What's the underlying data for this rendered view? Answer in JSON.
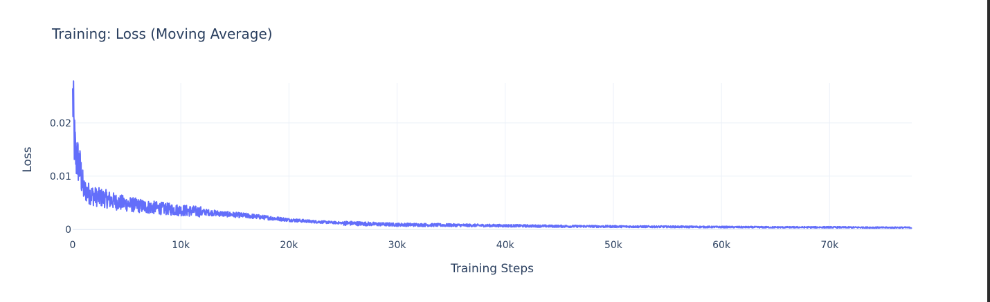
{
  "chart_data": {
    "type": "line",
    "title": "Training: Loss (Moving Average)",
    "xlabel": "Training Steps",
    "ylabel": "Loss",
    "xlim": [
      0,
      77600
    ],
    "ylim": [
      0,
      0.0275
    ],
    "xticks": [
      0,
      10000,
      20000,
      30000,
      40000,
      50000,
      60000,
      70000
    ],
    "xtick_labels": [
      "0",
      "10k",
      "20k",
      "30k",
      "40k",
      "50k",
      "60k",
      "70k"
    ],
    "yticks": [
      0,
      0.01,
      0.02
    ],
    "ytick_labels": [
      "0",
      "0.01",
      "0.02"
    ],
    "grid": true,
    "legend": "none",
    "colors": {
      "series": "#636efa",
      "grid": "#ebf0f8",
      "text": "#2a3f5f"
    },
    "series": [
      {
        "x": [
          0,
          100,
          200,
          300,
          500,
          700,
          1000,
          1500,
          2000,
          3000,
          4000,
          5000,
          6000,
          7000,
          8000,
          9000,
          10000,
          12000,
          14000,
          16000,
          18000,
          20000,
          22000,
          25000,
          28000,
          30000,
          35000,
          40000,
          45000,
          50000,
          55000,
          60000,
          65000,
          70000,
          75000,
          77600
        ],
        "y": [
          0.0265,
          0.019,
          0.0155,
          0.0135,
          0.0128,
          0.0112,
          0.0075,
          0.0068,
          0.0062,
          0.0058,
          0.0052,
          0.0048,
          0.0045,
          0.0042,
          0.004,
          0.0038,
          0.0036,
          0.0033,
          0.0029,
          0.0026,
          0.0022,
          0.0018,
          0.0015,
          0.0012,
          0.001,
          0.0009,
          0.0008,
          0.0007,
          0.0006,
          0.00055,
          0.0005,
          0.00045,
          0.0004,
          0.0004,
          0.00035,
          0.00035
        ]
      }
    ]
  }
}
